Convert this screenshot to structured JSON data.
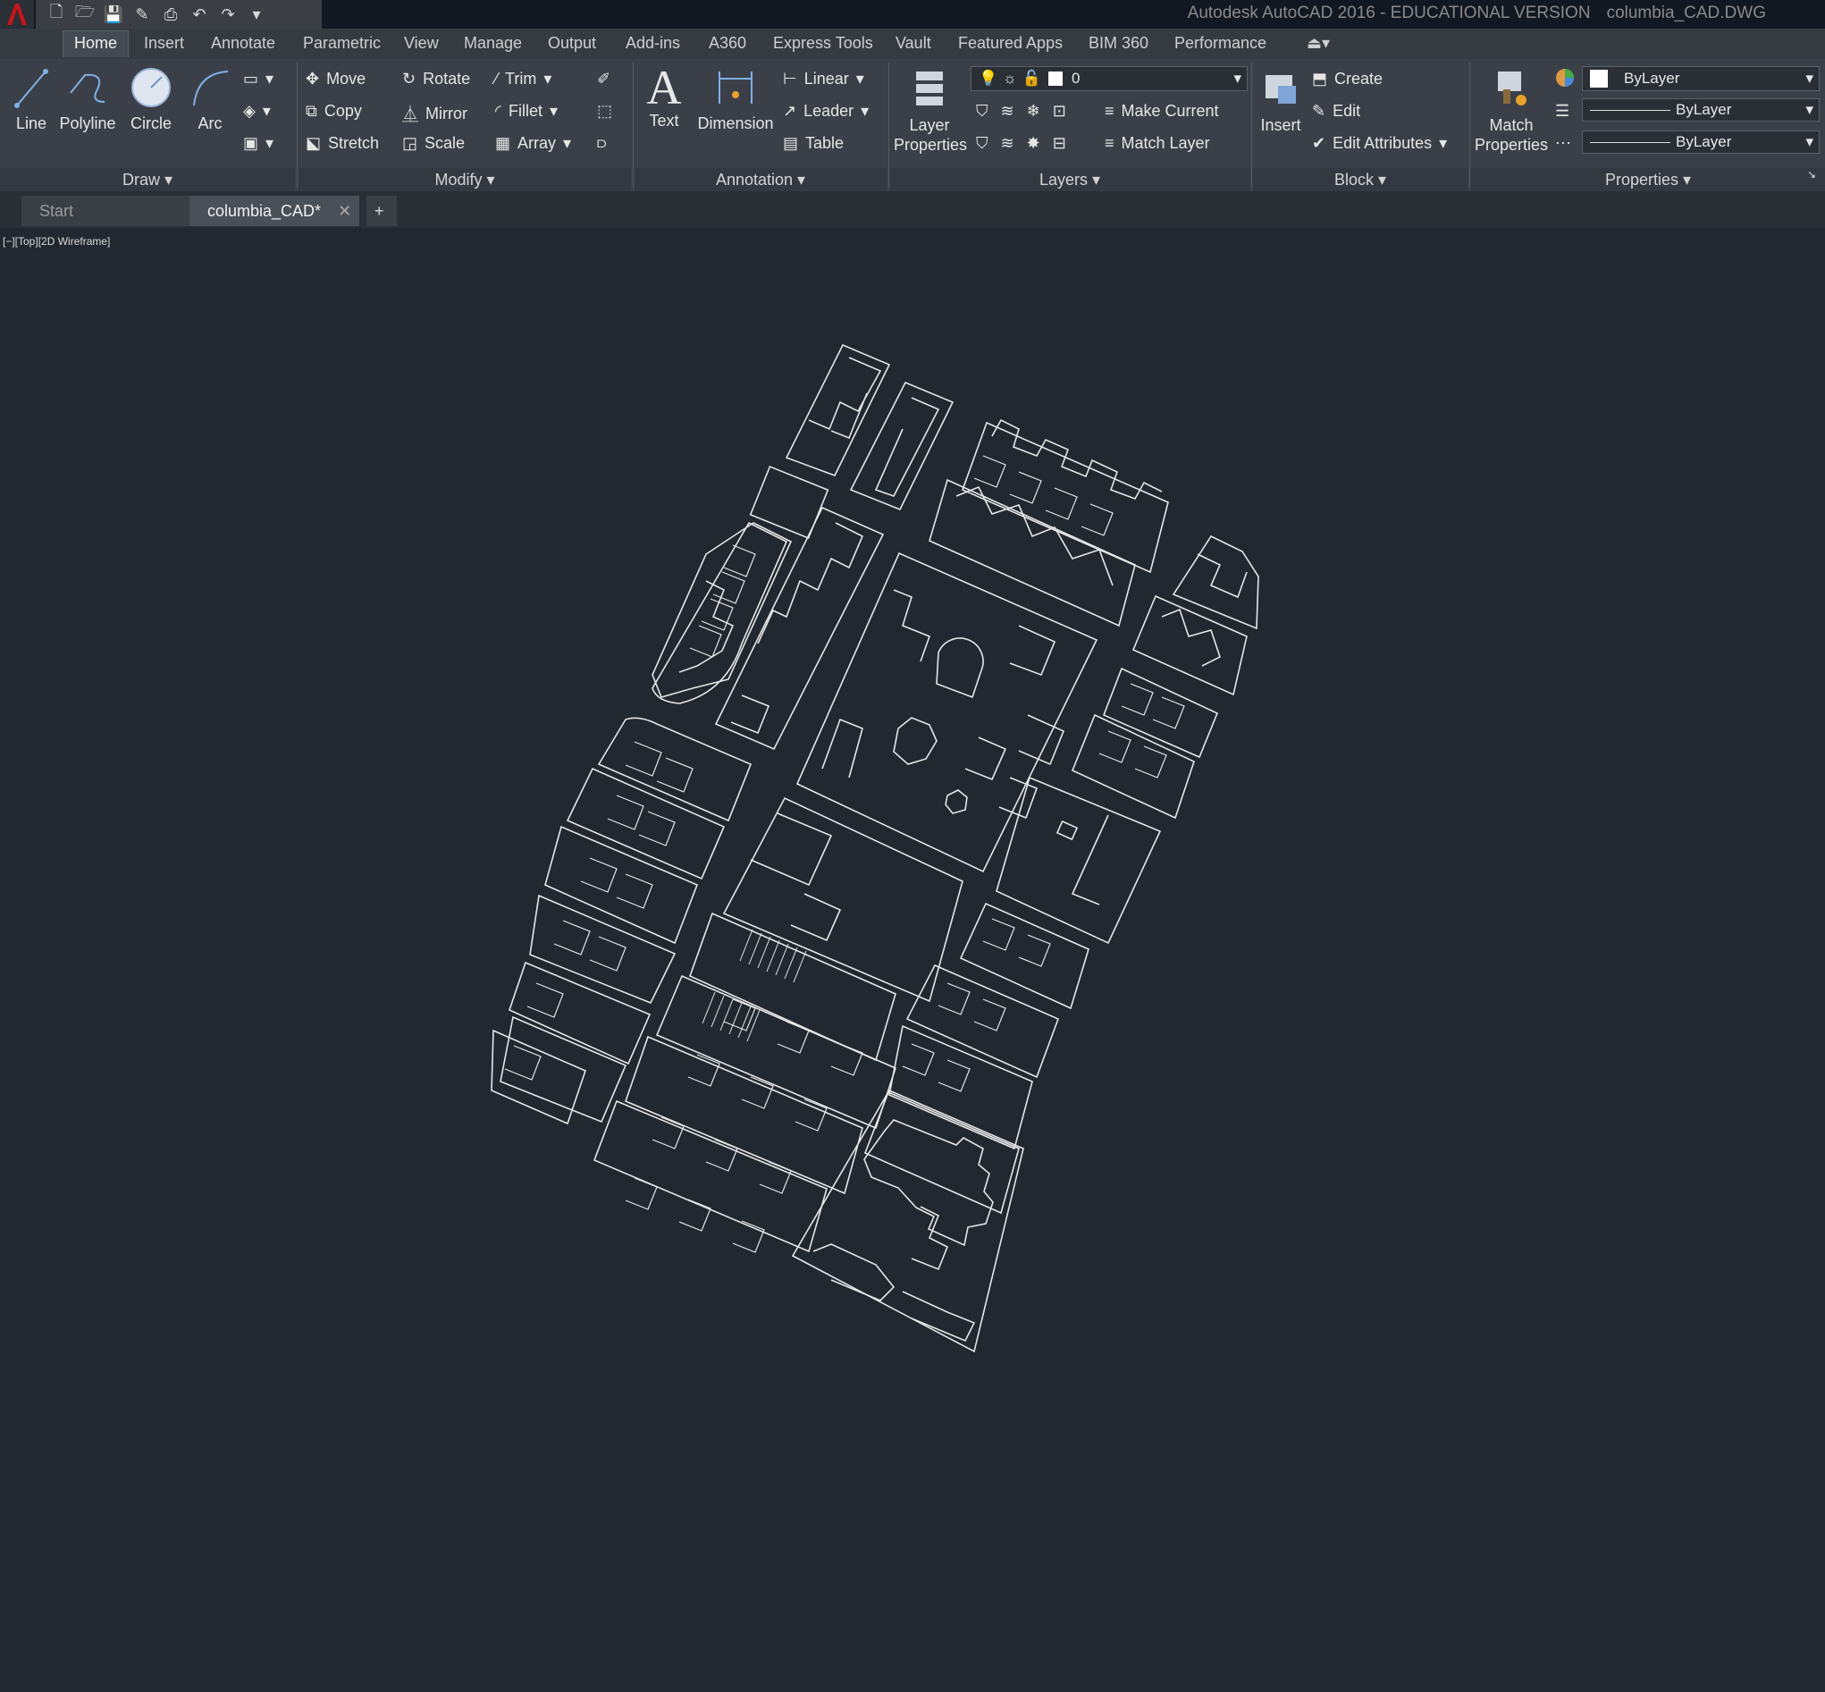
{
  "window": {
    "app_title": "Autodesk AutoCAD 2016 - EDUCATIONAL VERSION",
    "file_title": "columbia_CAD.DWG"
  },
  "qat": {
    "icons": [
      "new-icon",
      "open-icon",
      "save-icon",
      "save-as-icon",
      "plot-icon",
      "undo-icon",
      "redo-icon",
      "customize-icon"
    ]
  },
  "menu": {
    "tabs": [
      "Home",
      "Insert",
      "Annotate",
      "Parametric",
      "View",
      "Manage",
      "Output",
      "Add-ins",
      "A360",
      "Express Tools",
      "Vault",
      "Featured Apps",
      "BIM 360",
      "Performance"
    ]
  },
  "ribbon": {
    "draw": {
      "title": "Draw",
      "line": "Line",
      "polyline": "Polyline",
      "circle": "Circle",
      "arc": "Arc"
    },
    "modify": {
      "title": "Modify",
      "move": "Move",
      "rotate": "Rotate",
      "trim": "Trim",
      "copy": "Copy",
      "mirror": "Mirror",
      "fillet": "Fillet",
      "stretch": "Stretch",
      "scale": "Scale",
      "array": "Array"
    },
    "annotation": {
      "title": "Annotation",
      "text": "Text",
      "dimension": "Dimension",
      "linear": "Linear",
      "leader": "Leader",
      "table": "Table"
    },
    "layers": {
      "title": "Layers",
      "layer_properties_1": "Layer",
      "layer_properties_2": "Properties",
      "current_layer": "0",
      "make_current": "Make Current",
      "match_layer": "Match Layer"
    },
    "block": {
      "title": "Block",
      "insert": "Insert",
      "create": "Create",
      "edit": "Edit",
      "edit_attributes": "Edit Attributes"
    },
    "properties": {
      "title": "Properties",
      "match_1": "Match",
      "match_2": "Properties",
      "color": "ByLayer",
      "linetype": "ByLayer",
      "lineweight": "ByLayer"
    }
  },
  "file_tabs": {
    "start": "Start",
    "active": "columbia_CAD*"
  },
  "viewport": {
    "label": "[−][Top][2D Wireframe]"
  },
  "colors": {
    "background": "#212830",
    "linework": "#e6e6e6",
    "ribbon": "#3b4048",
    "accent": "#c4161c"
  }
}
